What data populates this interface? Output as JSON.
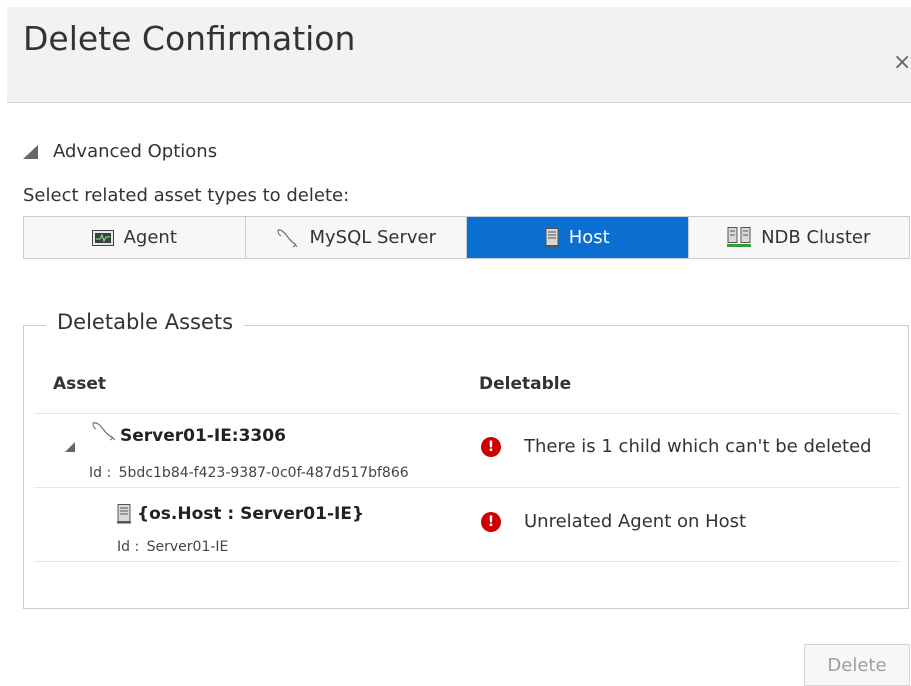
{
  "dialog": {
    "title": "Delete Confirmation",
    "close_glyph": "×"
  },
  "advanced": {
    "label": "Advanced Options"
  },
  "select_label": "Select related asset types to delete:",
  "tabs": [
    {
      "label": "Agent",
      "icon": "agent-icon",
      "active": false
    },
    {
      "label": "MySQL Server",
      "icon": "mysql-dolphin-icon",
      "active": false
    },
    {
      "label": "Host",
      "icon": "host-server-icon",
      "active": true
    },
    {
      "label": "NDB Cluster",
      "icon": "ndb-cluster-icon",
      "active": false
    }
  ],
  "assets": {
    "legend": "Deletable Assets",
    "columns": [
      "Asset",
      "Deletable"
    ],
    "rows": [
      {
        "name": "Server01-IE:3306",
        "id_label": "Id :",
        "id_value": "5bdc1b84-f423-9387-0c0f-487d517bf866",
        "status": "There is 1 child which can't be deleted",
        "icon": "mysql-dolphin-icon"
      },
      {
        "name": "{os.Host : Server01-IE}",
        "id_label": "Id :",
        "id_value": "Server01-IE",
        "status": "Unrelated Agent on Host",
        "icon": "host-server-icon"
      }
    ]
  },
  "footer": {
    "delete_label": "Delete"
  },
  "colors": {
    "active_tab": "#0a6fd0",
    "error": "#cc0000",
    "header_bg": "#f2f2f2"
  }
}
